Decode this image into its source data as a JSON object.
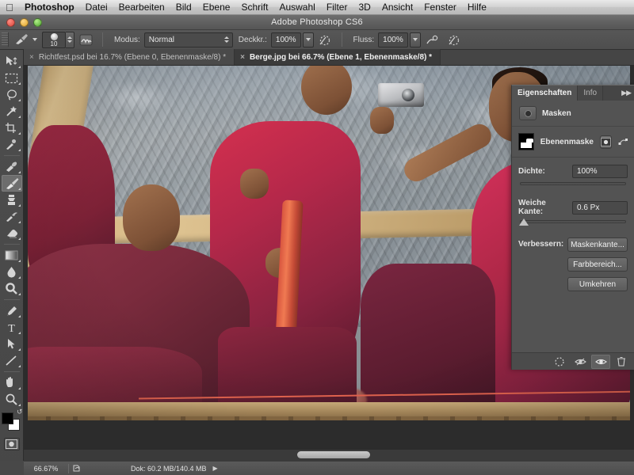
{
  "menubar": {
    "apple_icon": "apple-logo",
    "items": [
      "Photoshop",
      "Datei",
      "Bearbeiten",
      "Bild",
      "Ebene",
      "Schrift",
      "Auswahl",
      "Filter",
      "3D",
      "Ansicht",
      "Fenster",
      "Hilfe"
    ]
  },
  "titlebar": {
    "title": "Adobe Photoshop CS6"
  },
  "options_bar": {
    "brush_icon": "brush-icon",
    "brush_size": "10",
    "brush_panel_icon": "brush-panel-icon",
    "mode_label": "Modus:",
    "mode_value": "Normal",
    "opacity_label": "Deckkr.:",
    "opacity_value": "100%",
    "pressure_opacity_icon": "pressure-opacity-icon",
    "flow_label": "Fluss:",
    "flow_value": "100%",
    "airbrush_icon": "airbrush-icon",
    "pressure_size_icon": "pressure-size-icon"
  },
  "tabs": [
    {
      "label": "Richtfest.psd bei 16.7% (Ebene 0, Ebenenmaske/8) *",
      "close": "×",
      "active": false
    },
    {
      "label": "Berge.jpg bei 66.7% (Ebene 1, Ebenenmaske/8) *",
      "close": "×",
      "active": true
    }
  ],
  "toolbar": {
    "tools": [
      {
        "name": "move-tool",
        "active": false
      },
      {
        "name": "rectangular-marquee-tool",
        "active": false
      },
      {
        "name": "lasso-tool",
        "active": false
      },
      {
        "name": "magic-wand-tool",
        "active": false
      },
      {
        "name": "crop-tool",
        "active": false
      },
      {
        "name": "eyedropper-tool",
        "active": false
      },
      {
        "name": "healing-brush-tool",
        "active": false
      },
      {
        "name": "brush-tool",
        "active": true
      },
      {
        "name": "clone-stamp-tool",
        "active": false
      },
      {
        "name": "history-brush-tool",
        "active": false
      },
      {
        "name": "eraser-tool",
        "active": false
      },
      {
        "name": "gradient-tool",
        "active": false
      },
      {
        "name": "blur-tool",
        "active": false
      },
      {
        "name": "dodge-tool",
        "active": false
      },
      {
        "name": "pen-tool",
        "active": false
      },
      {
        "name": "type-tool",
        "active": false
      },
      {
        "name": "path-selection-tool",
        "active": false
      },
      {
        "name": "line-tool",
        "active": false
      },
      {
        "name": "hand-tool",
        "active": false
      },
      {
        "name": "zoom-tool",
        "active": false
      }
    ],
    "foreground_color": "#000000",
    "background_color": "#ffffff",
    "quickmask_icon": "quick-mask-icon"
  },
  "panel": {
    "tabs": [
      {
        "label": "Eigenschaften",
        "active": true
      },
      {
        "label": "Info",
        "active": false
      }
    ],
    "menu_icon": "panel-collapse-icon",
    "section_title": "Masken",
    "mask_name": "Ebenenmaske",
    "pixel_mask_icon": "pixel-mask-icon",
    "vector_mask_icon": "vector-mask-icon",
    "density_label": "Dichte:",
    "density_value": "100%",
    "density_percent": 100,
    "feather_label": "Weiche Kante:",
    "feather_value": "0.6 Px",
    "feather_percent": 3,
    "refine_label": "Verbessern:",
    "buttons": [
      {
        "label": "Maskenkante...",
        "name": "mask-edge-button"
      },
      {
        "label": "Farbbereich...",
        "name": "color-range-button"
      },
      {
        "label": "Umkehren",
        "name": "invert-button"
      }
    ],
    "footer_icons": [
      {
        "name": "load-selection-icon",
        "selected": false
      },
      {
        "name": "apply-mask-icon",
        "selected": false
      },
      {
        "name": "toggle-mask-visibility-icon",
        "selected": true
      },
      {
        "name": "delete-mask-icon",
        "selected": false
      }
    ]
  },
  "statusbar": {
    "zoom": "66.67%",
    "doc_icon": "document-icon",
    "doc_info": "Dok: 60.2 MB/140.4 MB",
    "arrow": "▶"
  },
  "canvas": {
    "scrollbar_name": "horizontal-scrollbar"
  }
}
